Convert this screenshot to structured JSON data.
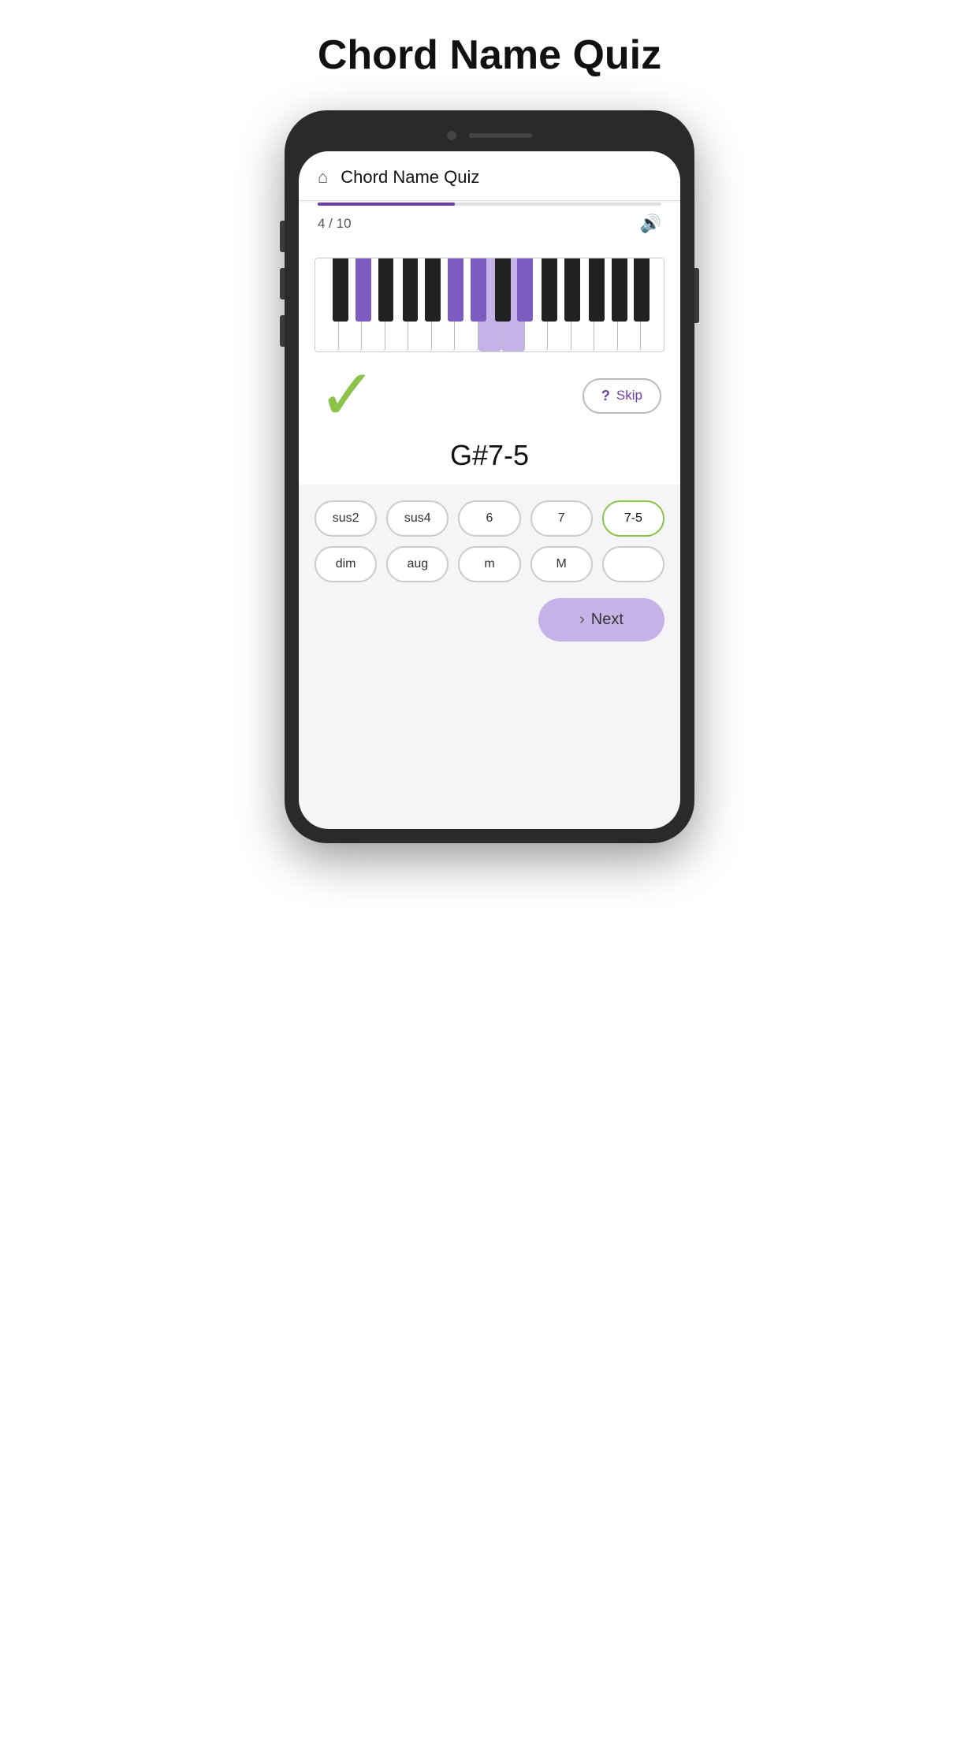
{
  "page": {
    "title": "Chord Name Quiz"
  },
  "app": {
    "header_title": "Chord Name Quiz",
    "progress_percent": 40,
    "counter": "4 / 10",
    "chord_name": "G#7-5",
    "feedback": "correct"
  },
  "piano": {
    "white_key_count": 15,
    "highlighted_whites": [
      7,
      8
    ],
    "black_key_positions": [
      {
        "left_pct": 5.5,
        "highlighted": false
      },
      {
        "left_pct": 12.5,
        "highlighted": true
      },
      {
        "left_pct": 19.5,
        "highlighted": false
      },
      {
        "left_pct": 26.5,
        "highlighted": false
      },
      {
        "left_pct": 33.5,
        "highlighted": false
      },
      {
        "left_pct": 39.5,
        "highlighted": true
      },
      {
        "left_pct": 46.5,
        "highlighted": true
      },
      {
        "left_pct": 53.5,
        "highlighted": false
      },
      {
        "left_pct": 60.5,
        "highlighted": true
      },
      {
        "left_pct": 67.5,
        "highlighted": false
      },
      {
        "left_pct": 73.5,
        "highlighted": false
      },
      {
        "left_pct": 80.5,
        "highlighted": false
      }
    ]
  },
  "answers": {
    "row1": [
      {
        "label": "sus2",
        "selected": false
      },
      {
        "label": "sus4",
        "selected": false
      },
      {
        "label": "6",
        "selected": false
      },
      {
        "label": "7",
        "selected": false
      },
      {
        "label": "7-5",
        "selected": true
      }
    ],
    "row2": [
      {
        "label": "dim",
        "selected": false
      },
      {
        "label": "aug",
        "selected": false
      },
      {
        "label": "m",
        "selected": false
      },
      {
        "label": "M",
        "selected": false
      },
      {
        "label": "",
        "selected": false
      }
    ]
  },
  "buttons": {
    "skip_label": "Skip",
    "next_label": "Next"
  },
  "icons": {
    "home": "⌂",
    "sound": "🔊",
    "question": "?",
    "chevron_right": "›"
  }
}
